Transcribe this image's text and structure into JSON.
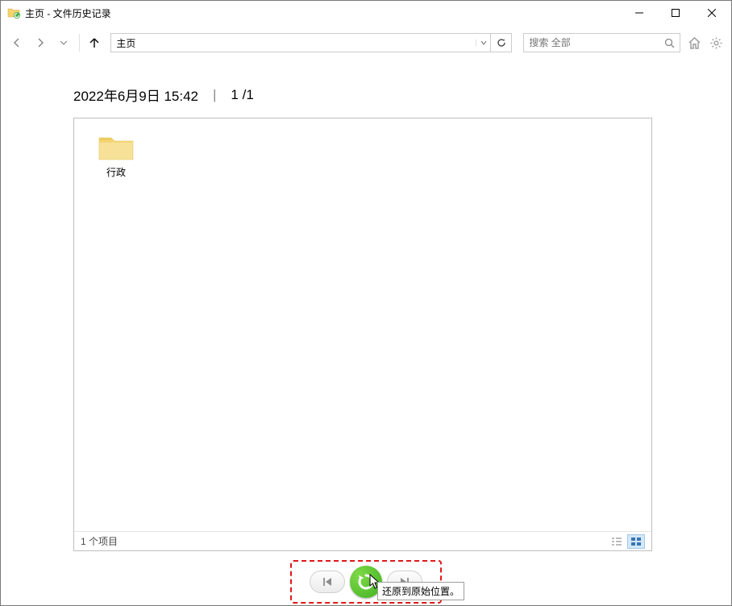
{
  "window": {
    "title": "主页 - 文件历史记录"
  },
  "nav": {
    "address": "主页",
    "search_placeholder": "搜索 全部"
  },
  "header": {
    "datetime": "2022年6月9日 15:42",
    "page_indicator": "1 /1"
  },
  "files": {
    "items": [
      {
        "name": "行政",
        "type": "folder"
      }
    ],
    "status_text": "1 个项目"
  },
  "controls": {
    "tooltip": "还原到原始位置。"
  }
}
